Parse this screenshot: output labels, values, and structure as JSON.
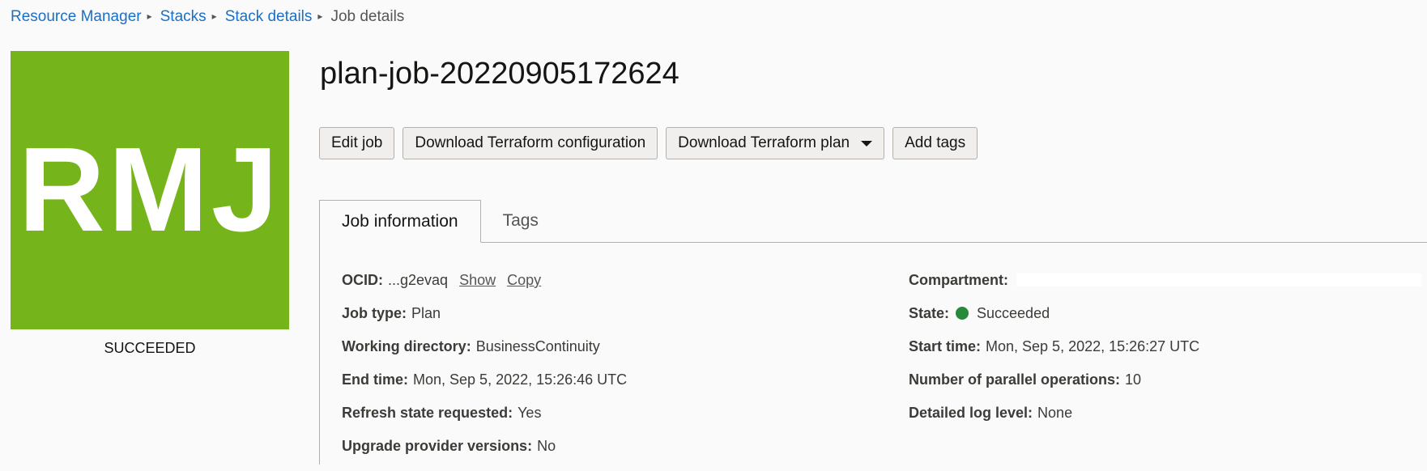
{
  "breadcrumb": {
    "items": [
      "Resource Manager",
      "Stacks",
      "Stack details"
    ],
    "current": "Job details"
  },
  "badge": {
    "initials": "RMJ",
    "status": "SUCCEEDED",
    "color": "#76b41b"
  },
  "page_title": "plan-job-20220905172624",
  "actions": {
    "edit_job": "Edit job",
    "download_config": "Download Terraform configuration",
    "download_plan": "Download Terraform plan",
    "add_tags": "Add tags"
  },
  "tabs": {
    "job_information": "Job information",
    "tags": "Tags"
  },
  "job_info": {
    "ocid_label": "OCID:",
    "ocid_value": "...g2evaq",
    "ocid_show": "Show",
    "ocid_copy": "Copy",
    "job_type_label": "Job type:",
    "job_type_value": "Plan",
    "working_dir_label": "Working directory:",
    "working_dir_value": "BusinessContinuity",
    "end_time_label": "End time:",
    "end_time_value": "Mon, Sep 5, 2022, 15:26:46 UTC",
    "refresh_label": "Refresh state requested:",
    "refresh_value": "Yes",
    "upgrade_label": "Upgrade provider versions:",
    "upgrade_value": "No",
    "compartment_label": "Compartment:",
    "state_label": "State:",
    "state_value": "Succeeded",
    "state_color": "#268a3a",
    "start_time_label": "Start time:",
    "start_time_value": "Mon, Sep 5, 2022, 15:26:27 UTC",
    "parallel_label": "Number of parallel operations:",
    "parallel_value": "10",
    "log_level_label": "Detailed log level:",
    "log_level_value": "None"
  }
}
